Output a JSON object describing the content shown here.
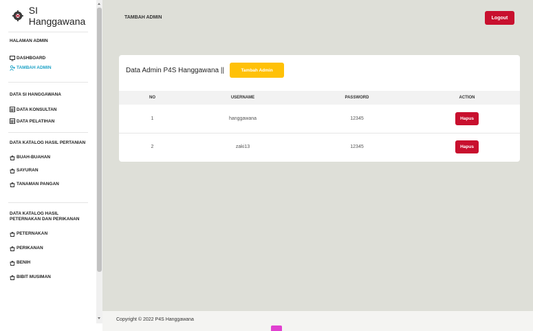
{
  "sidebar": {
    "brand_title": "SI Hanggawana",
    "sections": {
      "halaman_admin": "HALAMAN ADMIN",
      "data_si": "DATA SI HANGGAWANA",
      "katalog_pertanian": "DATA KATALOG HASIL PERTANIAN",
      "katalog_peternakan": "DATA KATALOG HASIL PETERNAKAN DAN PERIKANAN"
    },
    "items": {
      "dashboard": "DASHBOARD",
      "tambah_admin": "TAMBAH ADMIN",
      "data_konsultan": "DATA KONSULTAN",
      "data_pelatihan": "DATA PELATIHAN",
      "buah": "BUAH-BUAHAN",
      "sayuran": "SAYURAN",
      "tanaman": "TANAMAN PANGAN",
      "peternakan": "PETERNAKAN",
      "perikanan": "PERIKANAN",
      "benih": "BENIH",
      "bibit": "BIBIT MUSIMAN"
    }
  },
  "header": {
    "title": "TAMBAH ADMIN",
    "logout_label": "Logout"
  },
  "card": {
    "title": "Data Admin P4S Hanggawana ||",
    "add_button_label": "Tambah Admin",
    "columns": [
      "NO",
      "USERNAME",
      "PASSWORD",
      "ACTION"
    ],
    "rows": [
      {
        "no": "1",
        "username": "hanggawana",
        "password": "12345",
        "action": "Hapus"
      },
      {
        "no": "2",
        "username": "zaki13",
        "password": "12345",
        "action": "Hapus"
      }
    ]
  },
  "footer": {
    "copyright": "Copyright © 2022 P4S Hanggawana"
  },
  "colors": {
    "accent_active": "#1fa3c7",
    "danger": "#c8102e",
    "warning": "#ffc107",
    "main_bg": "#dedfd8"
  }
}
